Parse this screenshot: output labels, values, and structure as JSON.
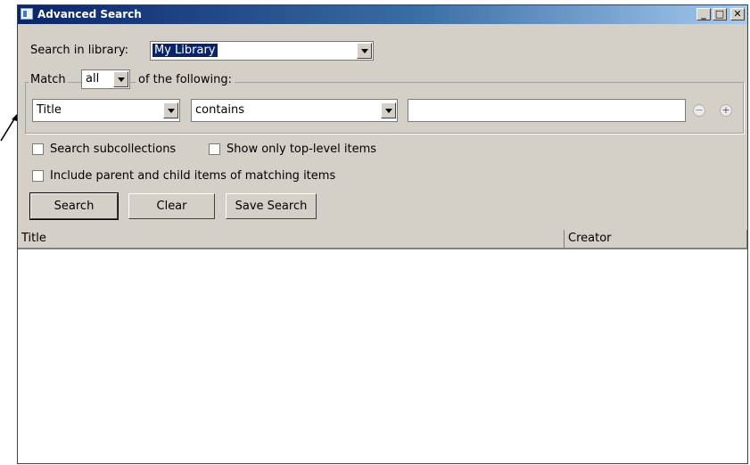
{
  "window": {
    "title": "Advanced Search",
    "controls": {
      "minimize": "_",
      "maximize": "□",
      "close": "✕"
    }
  },
  "library": {
    "label": "Search in library:",
    "selected": "My Library"
  },
  "match": {
    "label_prefix": "Match",
    "mode": "all",
    "label_suffix": "of the following:"
  },
  "condition": {
    "field": "Title",
    "operator": "contains",
    "value": "",
    "remove_icon": "minus-circle",
    "add_icon": "plus-circle"
  },
  "options": {
    "search_subcollections": {
      "label": "Search subcollections",
      "checked": false
    },
    "top_level_only": {
      "label": "Show only top-level items",
      "checked": false
    },
    "include_parent_child": {
      "label": "Include parent and child items of matching items",
      "checked": false
    }
  },
  "buttons": {
    "search": "Search",
    "clear": "Clear",
    "save_search": "Save Search"
  },
  "results": {
    "columns": [
      "Title",
      "Creator"
    ],
    "rows": []
  }
}
